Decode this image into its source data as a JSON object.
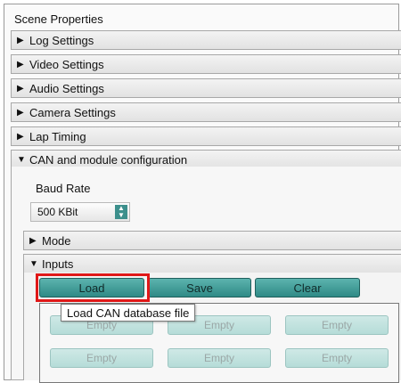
{
  "panel": {
    "title": "Scene Properties"
  },
  "sections": [
    {
      "label": "Log Settings",
      "arrow": "▶"
    },
    {
      "label": "Video Settings",
      "arrow": "▶"
    },
    {
      "label": "Audio Settings",
      "arrow": "▶"
    },
    {
      "label": "Camera Settings",
      "arrow": "▶"
    },
    {
      "label": "Lap Timing",
      "arrow": "▶"
    },
    {
      "label": "CAN and module configuration",
      "arrow": "▼"
    }
  ],
  "can": {
    "baud_label": "Baud Rate",
    "baud_value": "500 KBit",
    "mode_label": "Mode",
    "mode_arrow": "▶",
    "inputs_label": "Inputs",
    "inputs_arrow": "▼"
  },
  "toolbar": {
    "load_label": "Load",
    "save_label": "Save",
    "clear_label": "Clear"
  },
  "tooltip": "Load CAN database file",
  "slots": [
    "Empty",
    "Empty",
    "Empty",
    "Empty",
    "Empty",
    "Empty"
  ],
  "colors": {
    "accent": "#3c8f8c",
    "highlight": "#e01818"
  }
}
